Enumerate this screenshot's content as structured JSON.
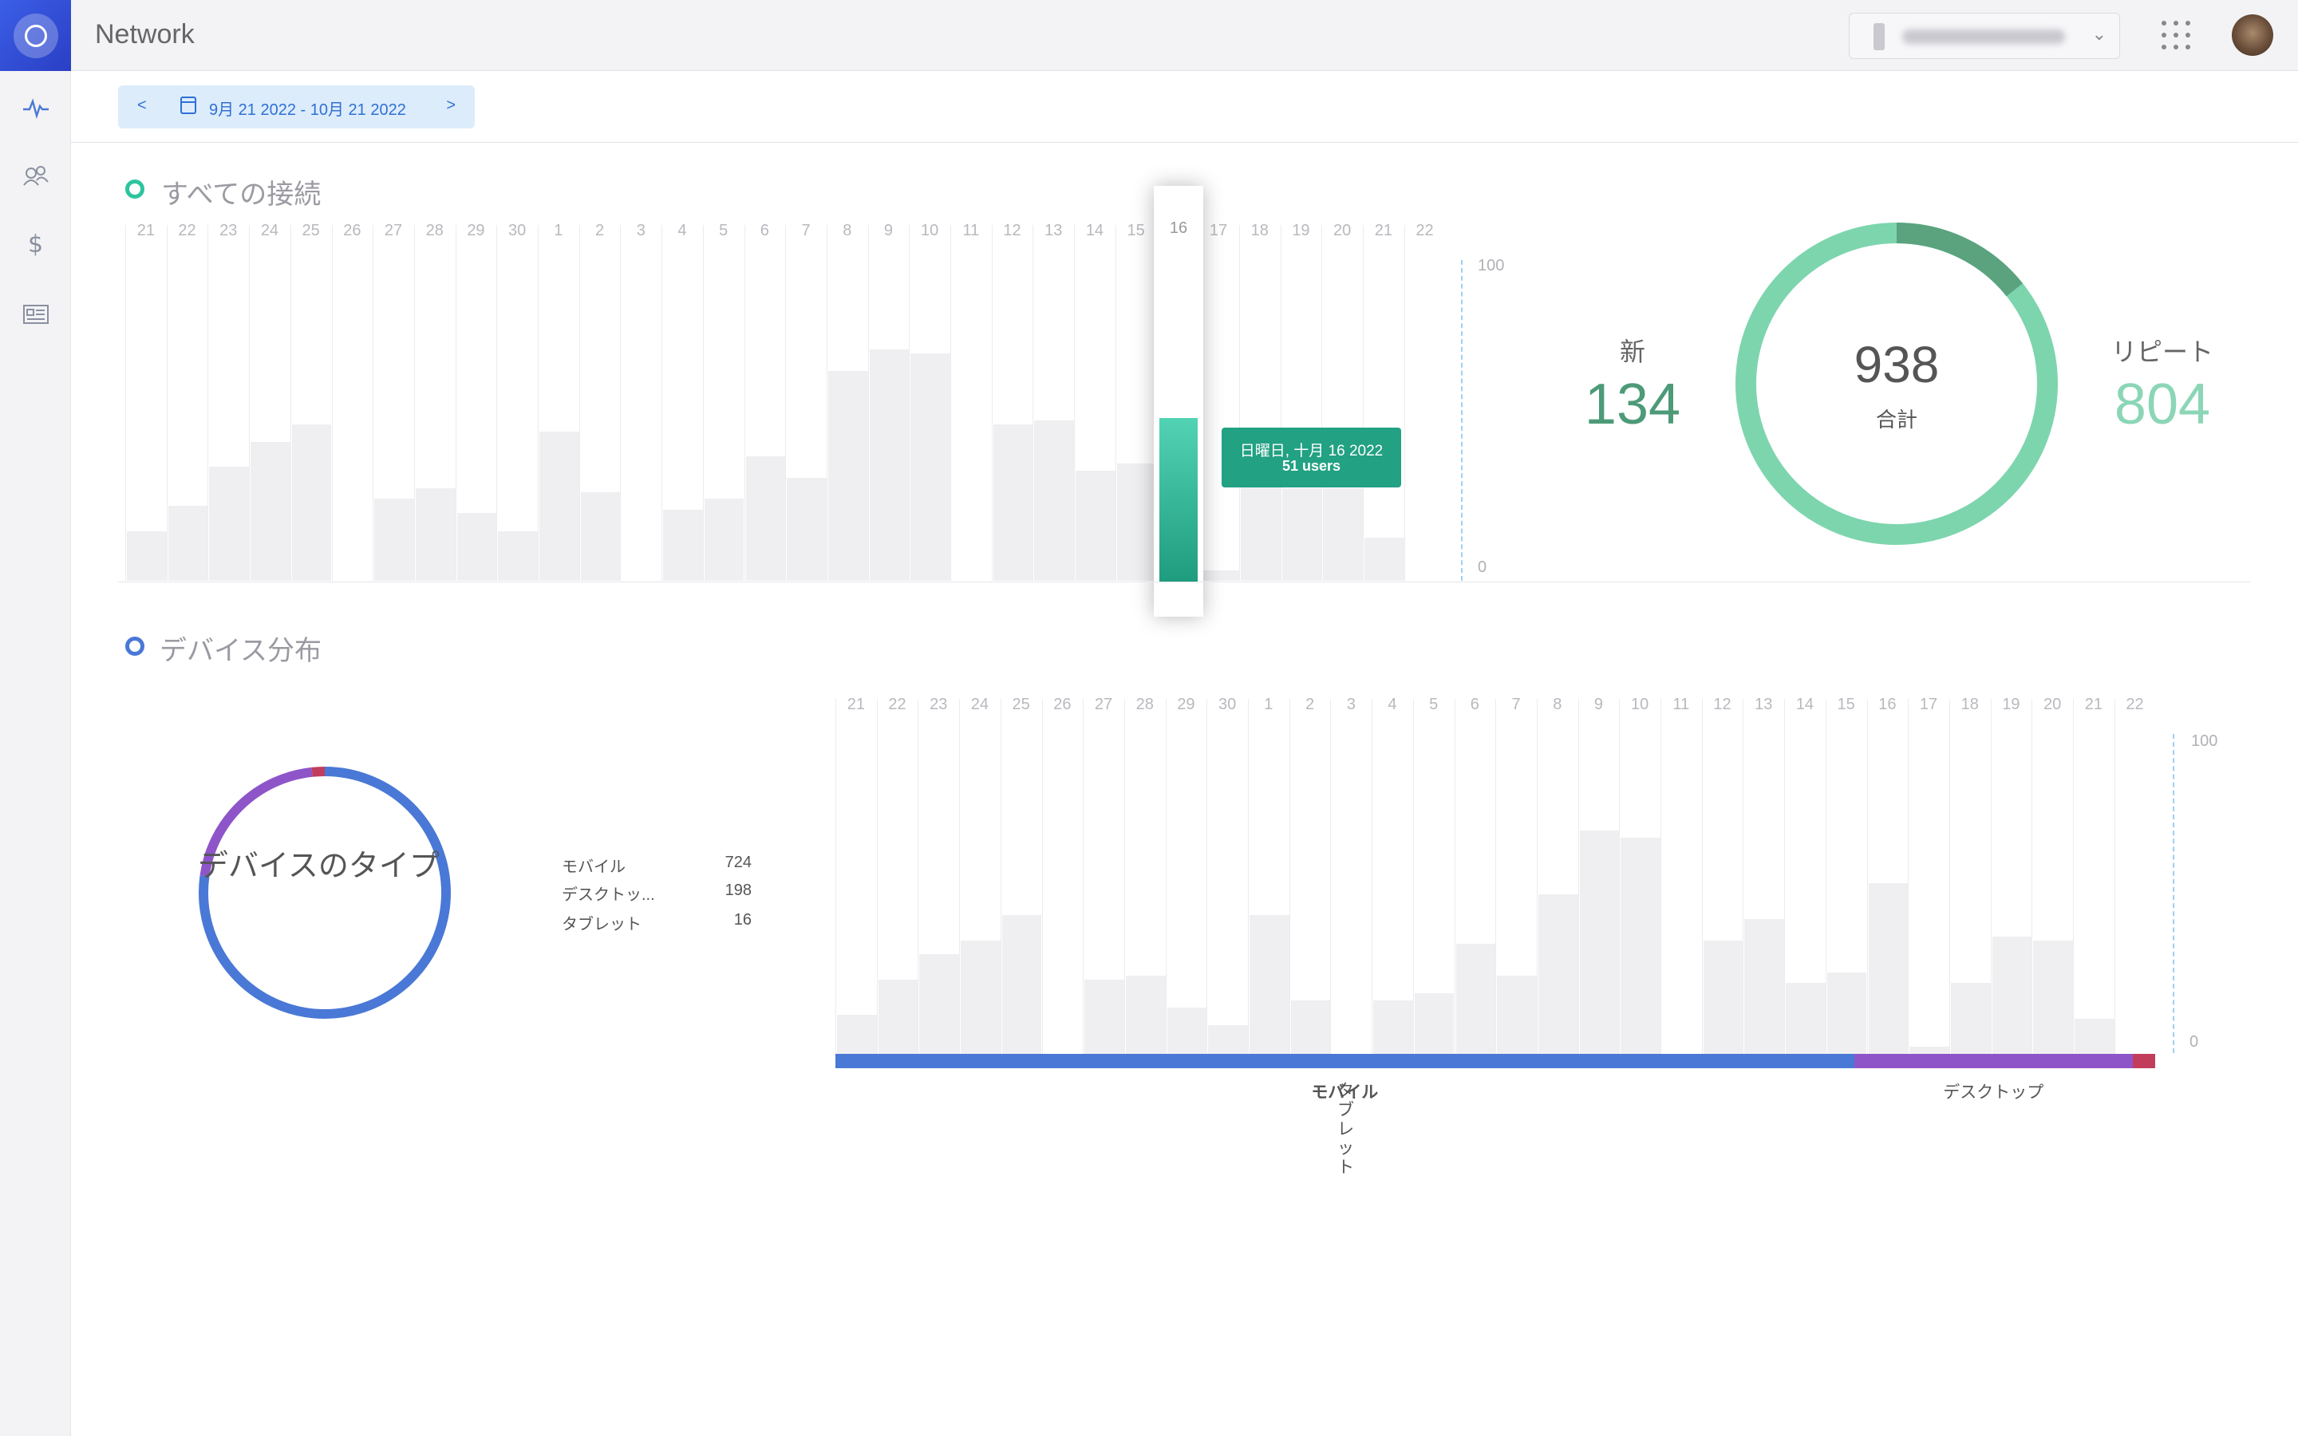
{
  "header": {
    "title": "Network"
  },
  "date_range": {
    "prev": "<",
    "label": "9月 21 2022 - 10月 21 2022",
    "next": ">"
  },
  "colors": {
    "accent_green": "#2ec4a0",
    "donut_green": "#7dd5ad",
    "donut_dark": "#5aa37e",
    "mobile": "#4a78d6",
    "desktop": "#8e55c9",
    "tablet": "#c23d5c",
    "new_num": "#4d9a78",
    "repeat_num": "#8bd6b6"
  },
  "connections": {
    "title": "すべての接続",
    "days": [
      "21",
      "22",
      "23",
      "24",
      "25",
      "26",
      "27",
      "28",
      "29",
      "30",
      "1",
      "2",
      "3",
      "4",
      "5",
      "6",
      "7",
      "8",
      "9",
      "10",
      "11",
      "12",
      "13",
      "14",
      "15",
      "16",
      "17",
      "18",
      "19",
      "20",
      "21",
      "22"
    ],
    "axis_max": "100",
    "axis_min": "0",
    "highlight_day": "16",
    "tooltip": {
      "date": "日曜日, 十月 16 2022",
      "users": "51 users"
    },
    "new_label": "新",
    "new_value": "134",
    "total_value": "938",
    "total_label": "合計",
    "repeat_label": "リピート",
    "repeat_value": "804"
  },
  "devices": {
    "title": "デバイス分布",
    "donut_label": "デバイスのタイプ",
    "legend": [
      {
        "name": "モバイル",
        "value": "724"
      },
      {
        "name": "デスクトッ...",
        "value": "198"
      },
      {
        "name": "タブレット",
        "value": "16"
      }
    ],
    "days": [
      "21",
      "22",
      "23",
      "24",
      "25",
      "26",
      "27",
      "28",
      "29",
      "30",
      "1",
      "2",
      "3",
      "4",
      "5",
      "6",
      "7",
      "8",
      "9",
      "10",
      "11",
      "12",
      "13",
      "14",
      "15",
      "16",
      "17",
      "18",
      "19",
      "20",
      "21",
      "22"
    ],
    "axis_max": "100",
    "axis_min": "0",
    "bar_labels": {
      "mobile": "モバイル",
      "desktop": "デスクトップ",
      "tablet": "タブレット"
    }
  },
  "chart_data": [
    {
      "type": "bar",
      "title": "すべての接続",
      "categories": [
        "21",
        "22",
        "23",
        "24",
        "25",
        "26",
        "27",
        "28",
        "29",
        "30",
        "1",
        "2",
        "3",
        "4",
        "5",
        "6",
        "7",
        "8",
        "9",
        "10",
        "11",
        "12",
        "13",
        "14",
        "15",
        "16",
        "17",
        "18",
        "19",
        "20",
        "21",
        "22"
      ],
      "values": [
        14,
        21,
        32,
        39,
        44,
        0,
        23,
        26,
        19,
        14,
        42,
        25,
        0,
        20,
        23,
        35,
        29,
        59,
        65,
        64,
        0,
        44,
        45,
        31,
        33,
        51,
        3,
        29,
        26,
        26,
        12,
        0
      ],
      "highlight": {
        "category": "16",
        "value": 51
      },
      "ylim": [
        0,
        100
      ]
    },
    {
      "type": "pie",
      "title": "新 / リピート",
      "labels": [
        "新",
        "リピート"
      ],
      "values": [
        134,
        804
      ]
    },
    {
      "type": "pie",
      "title": "デバイスのタイプ",
      "labels": [
        "モバイル",
        "デスクトップ",
        "タブレット"
      ],
      "values": [
        724,
        198,
        16
      ]
    },
    {
      "type": "bar",
      "title": "デバイス分布",
      "categories": [
        "21",
        "22",
        "23",
        "24",
        "25",
        "26",
        "27",
        "28",
        "29",
        "30",
        "1",
        "2",
        "3",
        "4",
        "5",
        "6",
        "7",
        "8",
        "9",
        "10",
        "11",
        "12",
        "13",
        "14",
        "15",
        "16",
        "17",
        "18",
        "19",
        "20",
        "21",
        "22"
      ],
      "values": [
        11,
        21,
        28,
        32,
        39,
        0,
        21,
        22,
        13,
        8,
        39,
        15,
        0,
        15,
        17,
        31,
        22,
        45,
        63,
        61,
        0,
        32,
        38,
        20,
        23,
        48,
        2,
        20,
        33,
        32,
        10,
        0
      ],
      "ylim": [
        0,
        100
      ]
    }
  ]
}
